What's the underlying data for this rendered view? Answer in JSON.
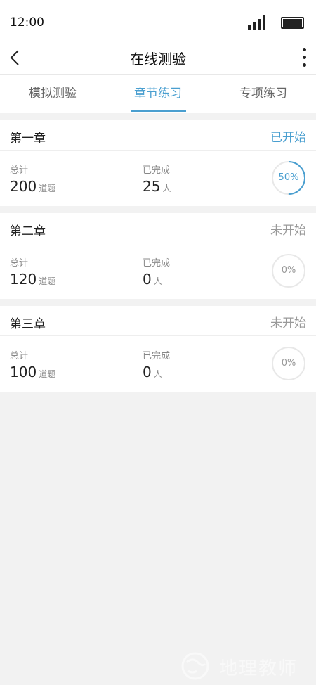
{
  "status_bar": {
    "time": "12:00"
  },
  "nav": {
    "title": "在线测验"
  },
  "tabs": [
    {
      "label": "模拟测验",
      "active": false
    },
    {
      "label": "章节练习",
      "active": true
    },
    {
      "label": "专项练习",
      "active": false
    }
  ],
  "chapters": [
    {
      "title": "第一章",
      "status": "已开始",
      "total_label": "总计",
      "total_value": "200",
      "total_unit": "道题",
      "done_label": "已完成",
      "done_value": "25",
      "done_unit": "人",
      "progress_text": "50%",
      "progress": 0.5
    },
    {
      "title": "第二章",
      "status": "未开始",
      "total_label": "总计",
      "total_value": "120",
      "total_unit": "道题",
      "done_label": "已完成",
      "done_value": "0",
      "done_unit": "人",
      "progress_text": "0%",
      "progress": 0
    },
    {
      "title": "第三章",
      "status": "未开始",
      "total_label": "总计",
      "total_value": "100",
      "total_unit": "道题",
      "done_label": "已完成",
      "done_value": "0",
      "done_unit": "人",
      "progress_text": "0%",
      "progress": 0
    }
  ],
  "colors": {
    "accent": "#4a9fd0",
    "muted": "#999999",
    "track": "#e8e8e8"
  },
  "watermark": {
    "text": "地理教师"
  }
}
